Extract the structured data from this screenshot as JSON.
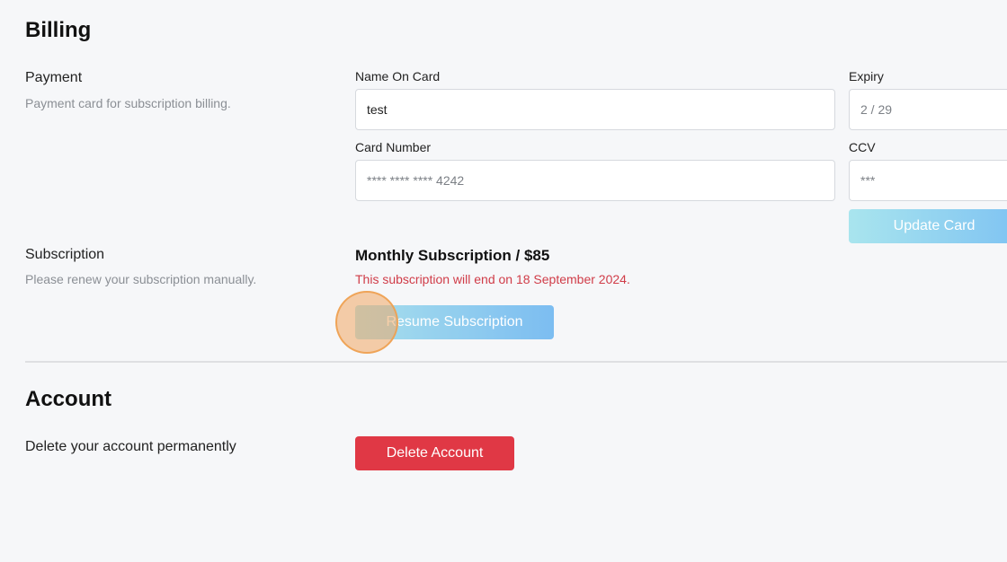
{
  "billing": {
    "title": "Billing",
    "payment": {
      "label": "Payment",
      "description": "Payment card for subscription billing.",
      "name_on_card_label": "Name On Card",
      "name_on_card_value": "test",
      "expiry_label": "Expiry",
      "expiry_value": "2 / 29",
      "card_number_label": "Card Number",
      "card_number_value": "**** **** **** 4242",
      "ccv_label": "CCV",
      "ccv_value": "***",
      "update_button": "Update Card"
    },
    "subscription": {
      "label": "Subscription",
      "description": "Please renew your subscription manually.",
      "plan": "Monthly Subscription / $85",
      "warning": "This subscription will end on 18 September 2024.",
      "resume_button": "Resume Subscription"
    }
  },
  "account": {
    "title": "Account",
    "delete_label": "Delete your account permanently",
    "delete_button": "Delete Account"
  },
  "colors": {
    "background": "#f6f7f9",
    "danger": "#e03845",
    "warning_text": "#d03c48",
    "accent_gradient_start": "#a8dfec",
    "accent_gradient_end": "#7cbdf1"
  }
}
